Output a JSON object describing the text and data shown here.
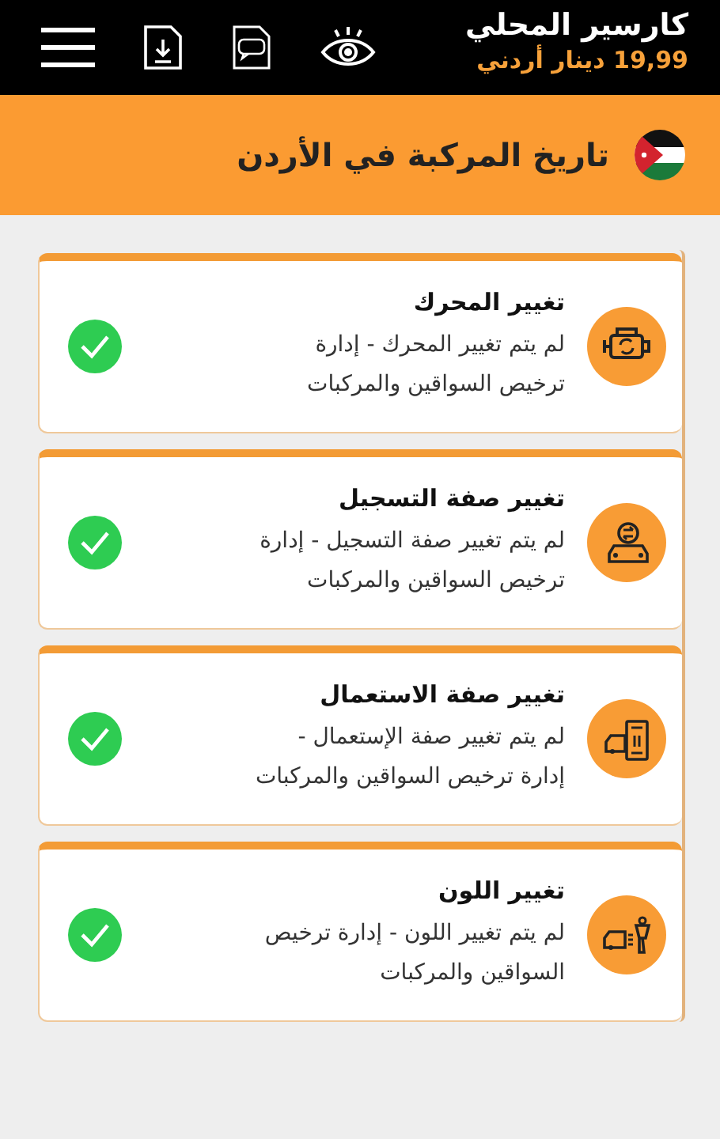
{
  "header": {
    "title": "كارسير المحلي",
    "price": "19,99 دينار أردني"
  },
  "banner": {
    "title": "تاريخ المركبة في الأردن"
  },
  "records": [
    {
      "title": "تغيير المحرك",
      "description": "لم يتم تغيير المحرك - إدارة ترخيص السواقين والمركبات",
      "checked": true
    },
    {
      "title": "تغيير صفة التسجيل",
      "description": "لم يتم تغيير صفة التسجيل - إدارة ترخيص السواقين والمركبات",
      "checked": true
    },
    {
      "title": "تغيير صفة الاستعمال",
      "description": "لم يتم تغيير صفة الإستعمال - إدارة ترخيص السواقين والمركبات",
      "checked": true
    },
    {
      "title": "تغيير اللون",
      "description": "لم يتم تغيير اللون - إدارة ترخيص السواقين والمركبات",
      "checked": true
    }
  ]
}
